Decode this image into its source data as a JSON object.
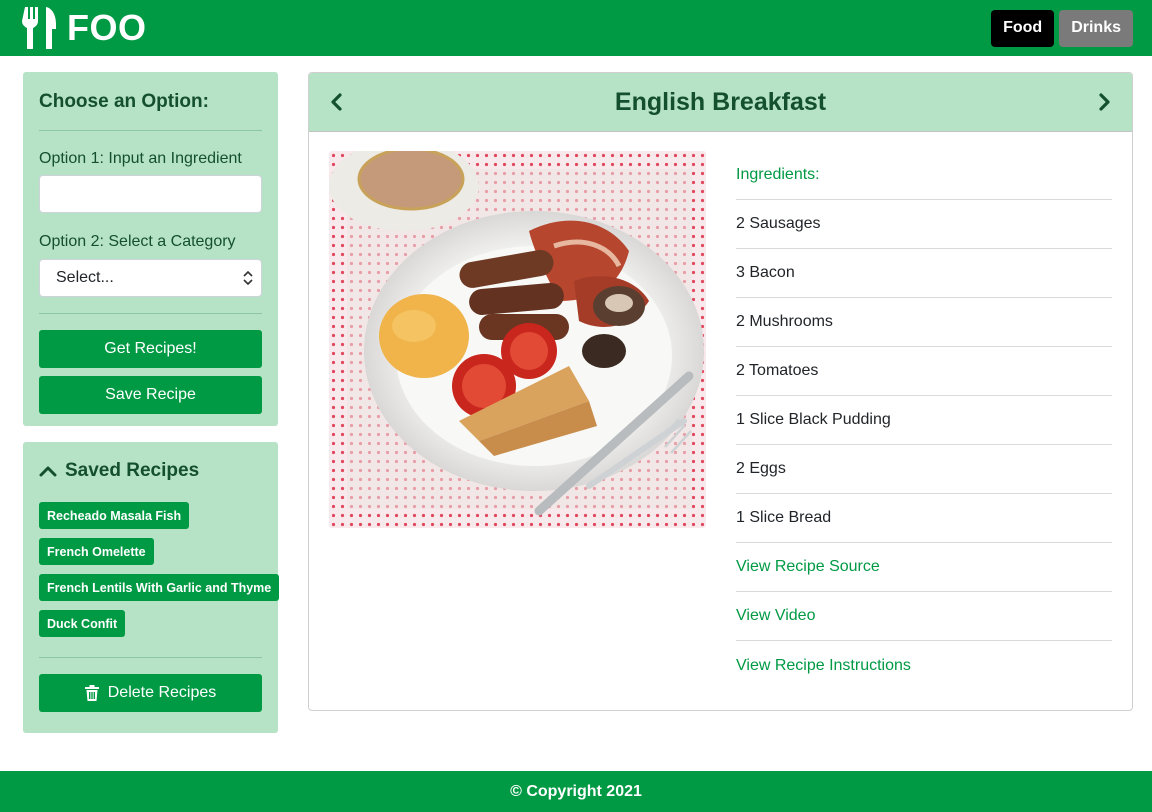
{
  "header": {
    "brand": "FOO",
    "brand_icon": "utensils-icon",
    "tabs": [
      {
        "label": "Food",
        "active": true
      },
      {
        "label": "Drinks",
        "active": false
      }
    ]
  },
  "options_panel": {
    "title": "Choose an Option:",
    "option1_label": "Option 1: Input an Ingredient",
    "ingredient_input_value": "",
    "option2_label": "Option 2: Select a Category",
    "category_select_value": "Select...",
    "get_recipes_label": "Get Recipes!",
    "save_recipe_label": "Save Recipe"
  },
  "saved_panel": {
    "title": "Saved Recipes",
    "toggle_icon": "chevron-up-icon",
    "recipes": [
      "Recheado Masala Fish",
      "French Omelette",
      "French Lentils With Garlic and Thyme",
      "Duck Confit"
    ],
    "delete_label": "Delete Recipes",
    "delete_icon": "trash-icon"
  },
  "recipe": {
    "title": "English Breakfast",
    "prev_icon": "chevron-left-icon",
    "next_icon": "chevron-right-icon",
    "ingredients_heading": "Ingredients:",
    "ingredients": [
      "2 Sausages",
      "3 Bacon",
      "2 Mushrooms",
      "2 Tomatoes",
      "1 Slice Black Pudding",
      "2 Eggs",
      "1 Slice Bread"
    ],
    "links": {
      "source": "View Recipe Source",
      "video": "View Video",
      "instructions": "View Recipe Instructions"
    }
  },
  "footer": {
    "copyright": "© Copyright 2021"
  },
  "colors": {
    "brand_green": "#009a44",
    "panel_green": "#b6e2c6",
    "title_green": "#14502e",
    "active_tab": "#000000",
    "inactive_tab": "#7a7a7a"
  }
}
